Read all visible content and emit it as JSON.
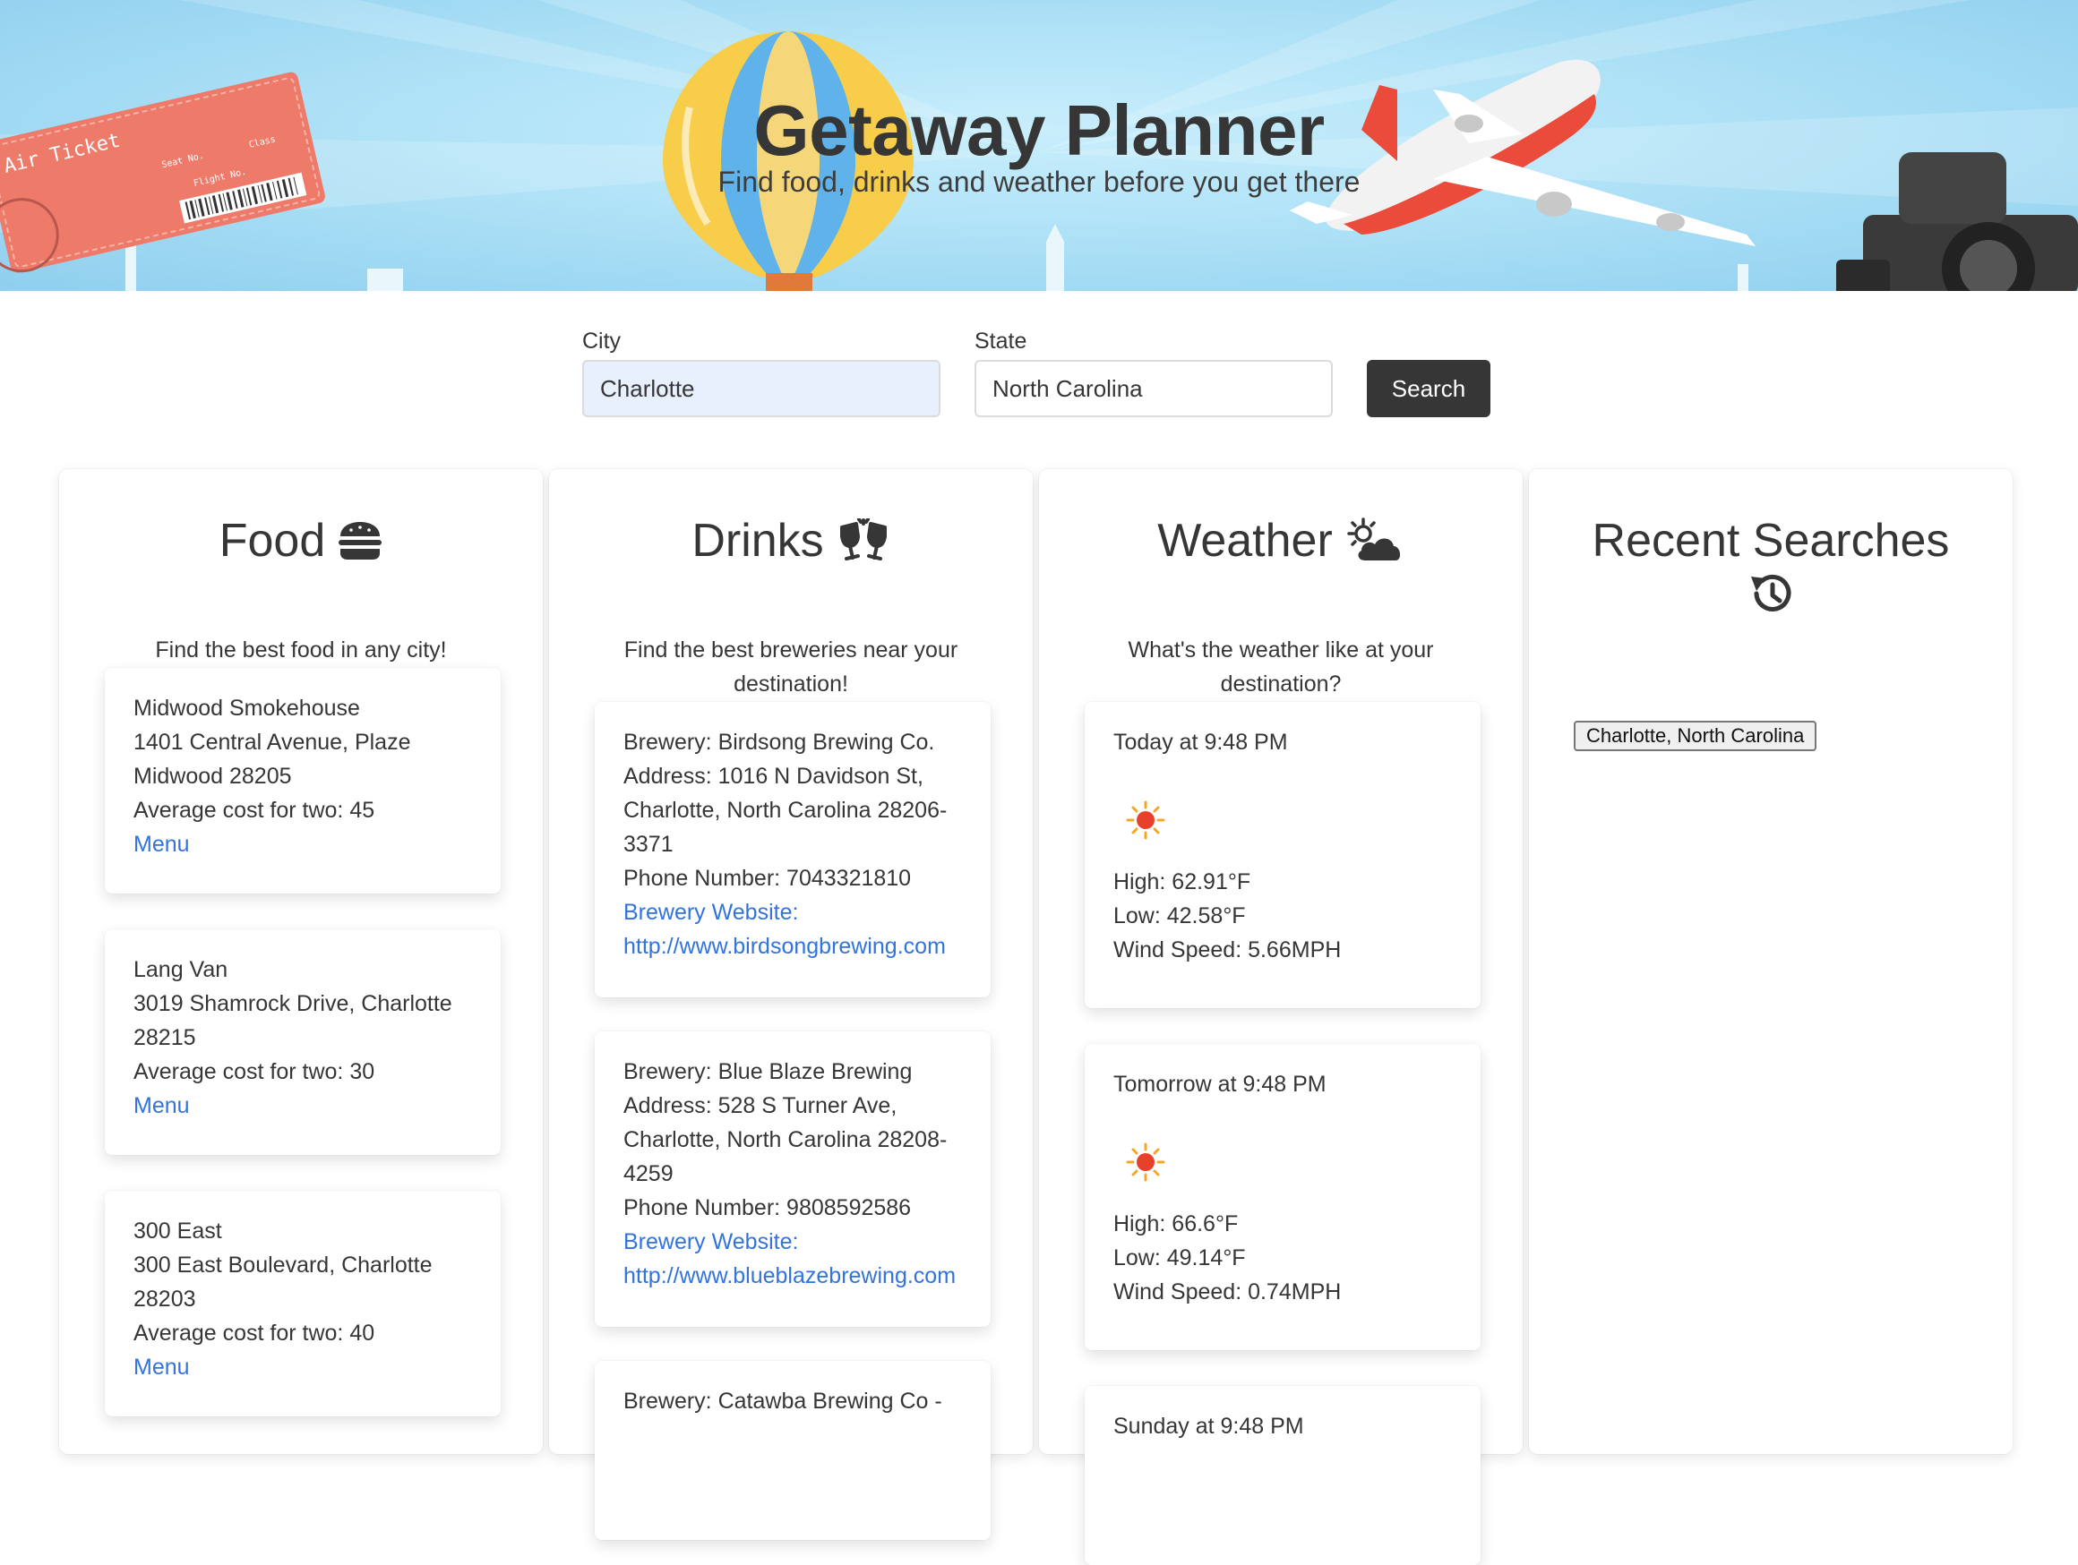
{
  "hero": {
    "title": "Getaway Planner",
    "subtitle": "Find food, drinks and weather before you get there",
    "ticket_text": "Air Ticket",
    "ticket_seat": "Seat No.",
    "ticket_class": "Class",
    "ticket_flight": "Flight No."
  },
  "search": {
    "city_label": "City",
    "city_value": "Charlotte",
    "state_label": "State",
    "state_value": "North Carolina",
    "button_label": "Search"
  },
  "food": {
    "title": "Food",
    "icon": "hamburger-icon",
    "description": "Find the best food in any city!",
    "items": [
      {
        "name": "Midwood Smokehouse",
        "address": "1401 Central Avenue, Plaze Midwood 28205",
        "cost": "Average cost for two: 45",
        "link": "Menu"
      },
      {
        "name": "Lang Van",
        "address": "3019 Shamrock Drive, Charlotte 28215",
        "cost": "Average cost for two: 30",
        "link": "Menu"
      },
      {
        "name": "300 East",
        "address": "300 East Boulevard, Charlotte 28203",
        "cost": "Average cost for two: 40",
        "link": "Menu"
      }
    ]
  },
  "drinks": {
    "title": "Drinks",
    "icon": "glass-cheers-icon",
    "description": "Find the best breweries near your destination!",
    "items": [
      {
        "brewery": "Brewery: Birdsong Brewing Co.",
        "address": "Address: 1016 N Davidson St, Charlotte, North Carolina 28206-3371",
        "phone": "Phone Number: 7043321810",
        "website_label": "Brewery Website:",
        "website": "http://www.birdsongbrewing.com"
      },
      {
        "brewery": "Brewery: Blue Blaze Brewing",
        "address": "Address: 528 S Turner Ave, Charlotte, North Carolina 28208-4259",
        "phone": "Phone Number: 9808592586",
        "website_label": "Brewery Website:",
        "website": "http://www.blueblazebrewing.com"
      },
      {
        "brewery": "Brewery: Catawba Brewing Co -"
      }
    ]
  },
  "weather": {
    "title": "Weather",
    "icon": "cloud-sun-icon",
    "description": "What's the weather like at your destination?",
    "items": [
      {
        "when": "Today at 9:48 PM",
        "icon": "sun-icon",
        "high": "High: 62.91°F",
        "low": "Low: 42.58°F",
        "wind": "Wind Speed: 5.66MPH"
      },
      {
        "when": "Tomorrow at 9:48 PM",
        "icon": "sun-icon",
        "high": "High: 66.6°F",
        "low": "Low: 49.14°F",
        "wind": "Wind Speed: 0.74MPH"
      },
      {
        "when": "Sunday at 9:48 PM"
      }
    ]
  },
  "recent": {
    "title": "Recent Searches",
    "icon": "history-icon",
    "items": [
      "Charlotte, North Carolina"
    ]
  },
  "colors": {
    "link": "#3273dc",
    "button": "#363636",
    "hero_sky": "#afe2f7"
  }
}
